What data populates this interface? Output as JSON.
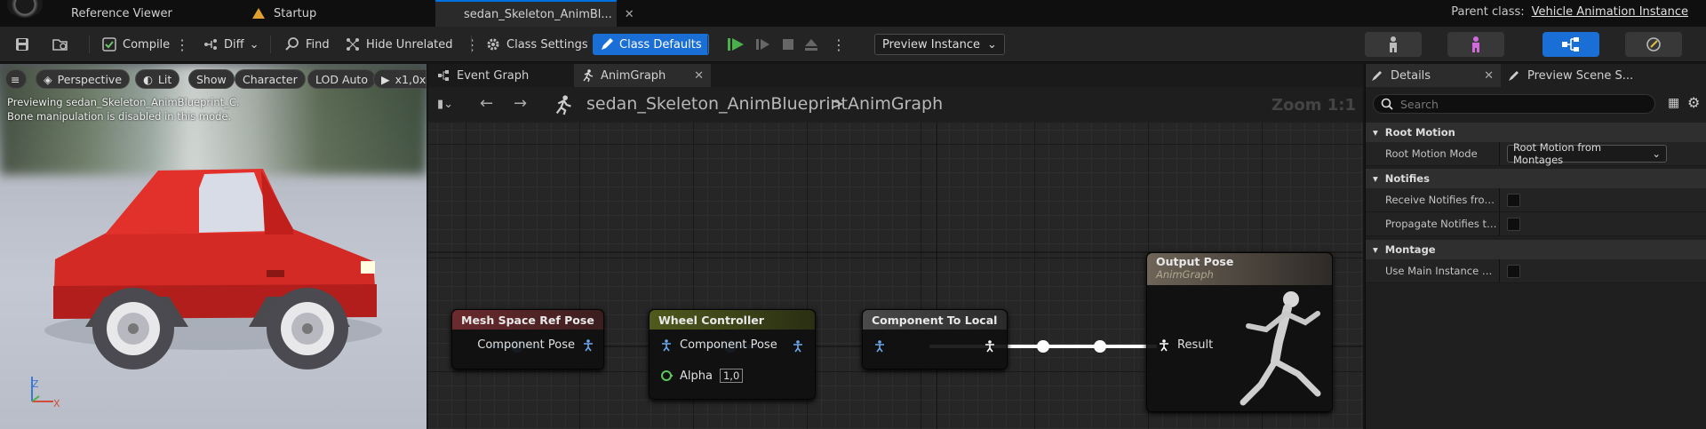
{
  "tabbar": {
    "tabs": [
      {
        "label": "Reference Viewer"
      },
      {
        "label": "Startup"
      },
      {
        "label": "sedan_Skeleton_AnimBl..."
      }
    ],
    "parent_class_label": "Parent class:",
    "parent_class_value": "Vehicle Animation Instance"
  },
  "toolbar": {
    "compile": "Compile",
    "diff": "Diff",
    "find": "Find",
    "hide_unrelated": "Hide Unrelated",
    "class_settings": "Class Settings",
    "class_defaults": "Class Defaults",
    "preview_instance": "Preview Instance"
  },
  "viewport": {
    "chips": [
      "Perspective",
      "Lit",
      "Show",
      "Character",
      "LOD Auto",
      "x1,0x"
    ],
    "message_line1": "Previewing sedan_Skeleton_AnimBlueprint_C.",
    "message_line2": "Bone manipulation is disabled in this mode.",
    "axis_z": "Z",
    "axis_x": "X"
  },
  "graph": {
    "tabs": [
      {
        "label": "Event Graph"
      },
      {
        "label": "AnimGraph"
      }
    ],
    "breadcrumb_root": "sedan_Skeleton_AnimBlueprint",
    "breadcrumb_sep": ">",
    "breadcrumb_leaf": "AnimGraph",
    "zoom": "Zoom 1:1",
    "nodes": {
      "mesh_space_ref_pose": {
        "title": "Mesh Space Ref Pose",
        "out_pin": "Component Pose"
      },
      "wheel_controller": {
        "title": "Wheel Controller",
        "in_pin": "Component Pose",
        "alpha_label": "Alpha",
        "alpha_value": "1,0"
      },
      "component_to_local": {
        "title": "Component To Local"
      },
      "output_pose": {
        "title": "Output Pose",
        "subtitle": "AnimGraph",
        "in_pin": "Result"
      }
    }
  },
  "details": {
    "tabs": [
      {
        "label": "Details"
      },
      {
        "label": "Preview Scene S..."
      }
    ],
    "search_placeholder": "Search",
    "categories": [
      {
        "label": "Root Motion",
        "props": [
          {
            "name": "Root Motion Mode",
            "value": "Root Motion from Montages"
          }
        ]
      },
      {
        "label": "Notifies",
        "props": [
          {
            "name": "Receive Notifies from..."
          },
          {
            "name": "Propagate Notifies to..."
          }
        ]
      },
      {
        "label": "Montage",
        "props": [
          {
            "name": "Use Main Instance Mo..."
          }
        ]
      }
    ]
  },
  "colors": {
    "accent": "#1a6fd6",
    "pose_link": "#6aa9f0",
    "exec_link": "#ffffff",
    "mesh_space_header": "#6b2a2e",
    "wheel_controller_header": "#4f5a1c",
    "component_to_local_header": "#4a4a4a",
    "output_pose_header": "#6e6458"
  }
}
